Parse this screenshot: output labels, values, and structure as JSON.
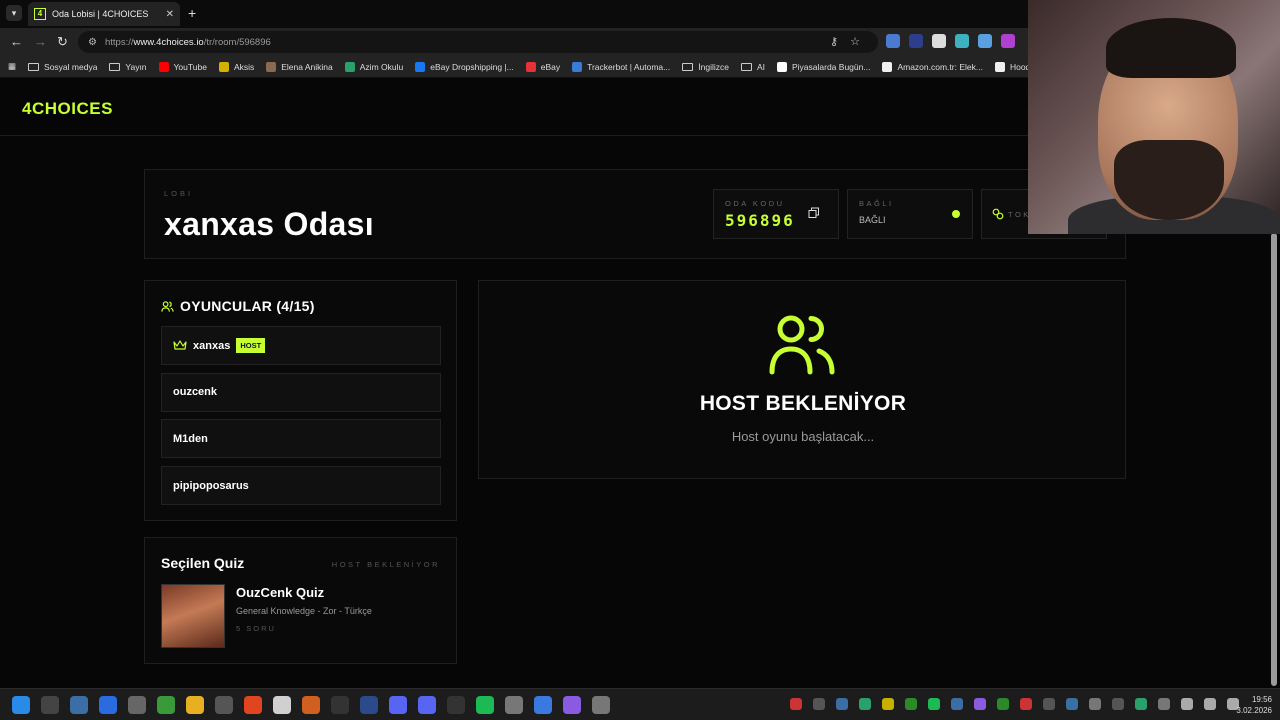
{
  "browser": {
    "tab_title": "Oda Lobisi | 4CHOICES",
    "tab_favicon_text": "4",
    "url_prefix": "https://",
    "url_host": "www.4choices.io",
    "url_path": "/tr/room/596896"
  },
  "bookmarks": [
    {
      "label": "Sosyal medya",
      "type": "folder"
    },
    {
      "label": "Yayın",
      "type": "folder"
    },
    {
      "label": "YouTube",
      "type": "link",
      "color": "#ff0000"
    },
    {
      "label": "Aksis",
      "type": "link",
      "color": "#d4b000"
    },
    {
      "label": "Elena Anikina",
      "type": "link",
      "color": "#8a6a50"
    },
    {
      "label": "Azim Okulu",
      "type": "link",
      "color": "#2aa06a"
    },
    {
      "label": "eBay Dropshipping |...",
      "type": "link",
      "color": "#1877f2"
    },
    {
      "label": "eBay",
      "type": "link",
      "color": "#e53238"
    },
    {
      "label": "Trackerbot | Automa...",
      "type": "link",
      "color": "#3a7bd5"
    },
    {
      "label": "İngilizce",
      "type": "folder"
    },
    {
      "label": "AI",
      "type": "folder"
    },
    {
      "label": "Piyasalarda Bugün...",
      "type": "link",
      "color": "#ffffff"
    },
    {
      "label": "Amazon.com.tr: Elek...",
      "type": "link",
      "color": "#f0f0f0"
    },
    {
      "label": "Hoodie Modelleri |",
      "type": "link",
      "color": "#f0f0f0"
    }
  ],
  "site": {
    "brand": "4CHOICES",
    "accent": "#c6ff32"
  },
  "lobby": {
    "kicker": "LOBI",
    "title": "xanxas Odası",
    "room_code_label": "ODA KODU",
    "room_code": "596896",
    "connection_label": "BAĞLI",
    "connection_value": "BAĞLI",
    "token_label": "TOK"
  },
  "players": {
    "heading": "OYUNCULAR (4/15)",
    "host_badge": "HOST",
    "list": [
      {
        "name": "xanxas",
        "is_host": true
      },
      {
        "name": "ouzcenk",
        "is_host": false
      },
      {
        "name": "M1den",
        "is_host": false
      },
      {
        "name": "pipipoposarus",
        "is_host": false
      }
    ]
  },
  "waiting": {
    "heading": "HOST BEKLENİYOR",
    "subtext": "Host oyunu başlatacak..."
  },
  "quiz": {
    "heading": "Seçilen Quiz",
    "status": "HOST BEKLENİYOR",
    "title": "OuzCenk Quiz",
    "subtitle": "General Knowledge - Zor - Türkçe",
    "count": "5 SORU"
  },
  "taskbar": {
    "time": "19:56",
    "date": "3.02.2026"
  }
}
